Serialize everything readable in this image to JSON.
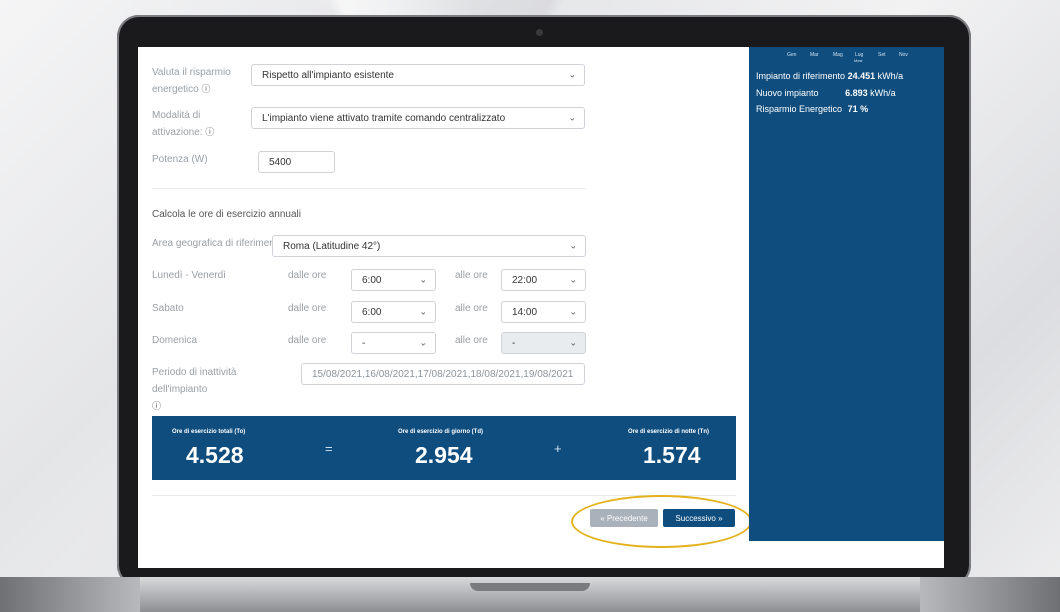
{
  "chart_axis": {
    "months": [
      "Gen",
      "Mar",
      "Mag",
      "Lug",
      "Set",
      "Nov"
    ],
    "axis_label": "Mesi"
  },
  "summary_side": {
    "rows": [
      {
        "label": "Impianto di riferimento",
        "value": "24.451",
        "unit": "kWh/a"
      },
      {
        "label": "Nuovo impianto",
        "value": "6.893",
        "unit": "kWh/a"
      },
      {
        "label": "Risparmio Energetico",
        "value": "71 %",
        "unit": ""
      }
    ]
  },
  "form": {
    "valuta": {
      "label": "Valuta il risparmio energetico",
      "value": "Rispetto all'impianto esistente"
    },
    "modalita": {
      "label": "Modalità di attivazione:",
      "value": "L'impianto viene attivato tramite comando centralizzato"
    },
    "potenza": {
      "label": "Potenza (W)",
      "value": "5400"
    },
    "section_title": "Calcola le ore di esercizio annuali",
    "area": {
      "label": "Area geografica di riferimento",
      "value": "Roma (Latitudine 42°)"
    },
    "from_label": "dalle ore",
    "to_label": "alle ore",
    "days": [
      {
        "label": "Lunedì - Venerdì",
        "from": "6:00",
        "to": "22:00"
      },
      {
        "label": "Sabato",
        "from": "6:00",
        "to": "14:00"
      },
      {
        "label": "Domenica",
        "from": "-",
        "to": "-"
      }
    ],
    "inattivita": {
      "label": "Periodo di inattività dell'impianto",
      "value": "15/08/2021,16/08/2021,17/08/2021,18/08/2021,19/08/2021"
    }
  },
  "totals": {
    "total": {
      "label": "Ore di esercizio totali (To)",
      "value": "4.528"
    },
    "eq": "=",
    "day": {
      "label": "Ore di esercizio di giorno (Td)",
      "value": "2.954"
    },
    "plus": "+",
    "night": {
      "label": "Ore di esercizio di notte (Tn)",
      "value": "1.574"
    }
  },
  "nav": {
    "prev": "« Precedente",
    "next": "Successivo »"
  },
  "colors": {
    "primary": "#0f4d7e",
    "highlight": "#e3b21b"
  }
}
